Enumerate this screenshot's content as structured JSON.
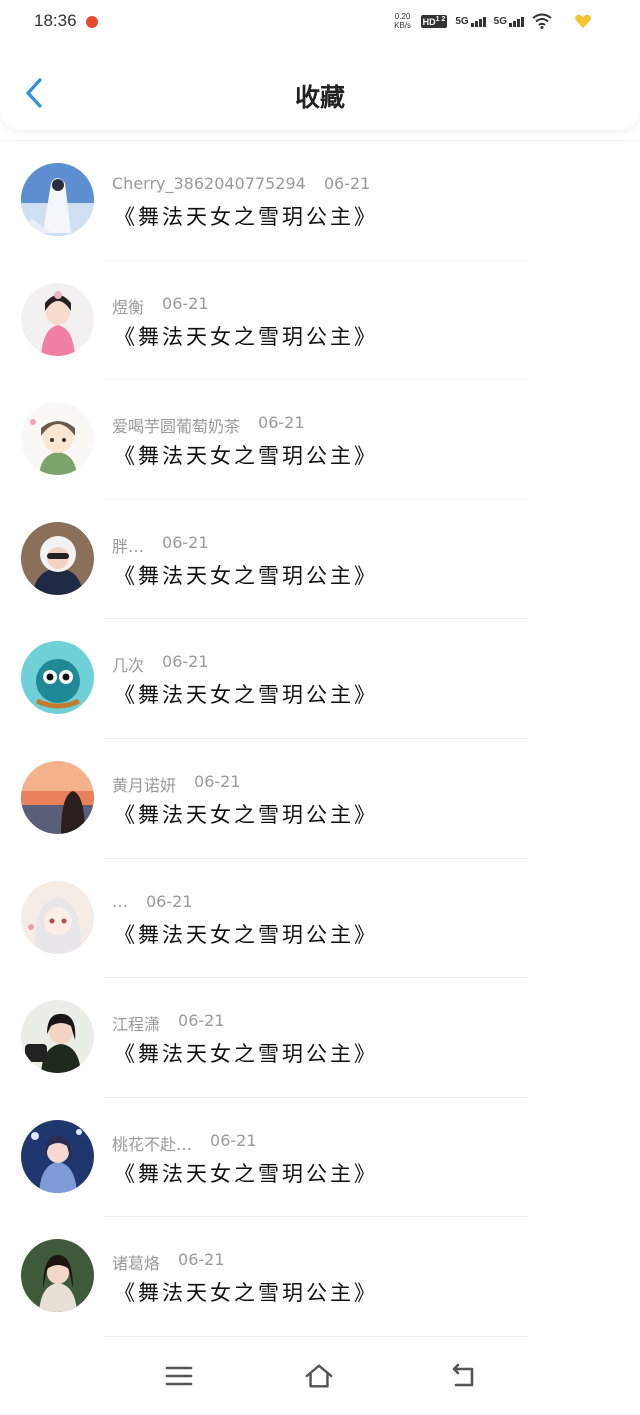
{
  "status": {
    "time": "18:36",
    "speed_value": "0.20",
    "speed_unit": "KB/s",
    "hd": "HD",
    "hd_sub": "1 2",
    "sig1": "5G",
    "sig2": "5G"
  },
  "header": {
    "title": "收藏"
  },
  "items": [
    {
      "user": "Cherry_3862040775294",
      "date": "06-21",
      "book": "《舞法天女之雪玥公主》"
    },
    {
      "user": "煜衡",
      "date": "06-21",
      "book": "《舞法天女之雪玥公主》"
    },
    {
      "user": "爱喝芋圆葡萄奶茶",
      "date": "06-21",
      "book": "《舞法天女之雪玥公主》"
    },
    {
      "user": "胖…",
      "date": "06-21",
      "book": "《舞法天女之雪玥公主》"
    },
    {
      "user": "几次",
      "date": "06-21",
      "book": "《舞法天女之雪玥公主》"
    },
    {
      "user": "黄月诺妍",
      "date": "06-21",
      "book": "《舞法天女之雪玥公主》"
    },
    {
      "user": "…",
      "date": "06-21",
      "book": "《舞法天女之雪玥公主》"
    },
    {
      "user": "江程潇",
      "date": "06-21",
      "book": "《舞法天女之雪玥公主》"
    },
    {
      "user": "桃花不赴…",
      "date": "06-21",
      "book": "《舞法天女之雪玥公主》"
    },
    {
      "user": "诸葛烙",
      "date": "06-21",
      "book": "《舞法天女之雪玥公主》"
    }
  ],
  "colors": {
    "accent": "#2f8ee8",
    "muted": "#9a9a9a",
    "text": "#111111"
  }
}
